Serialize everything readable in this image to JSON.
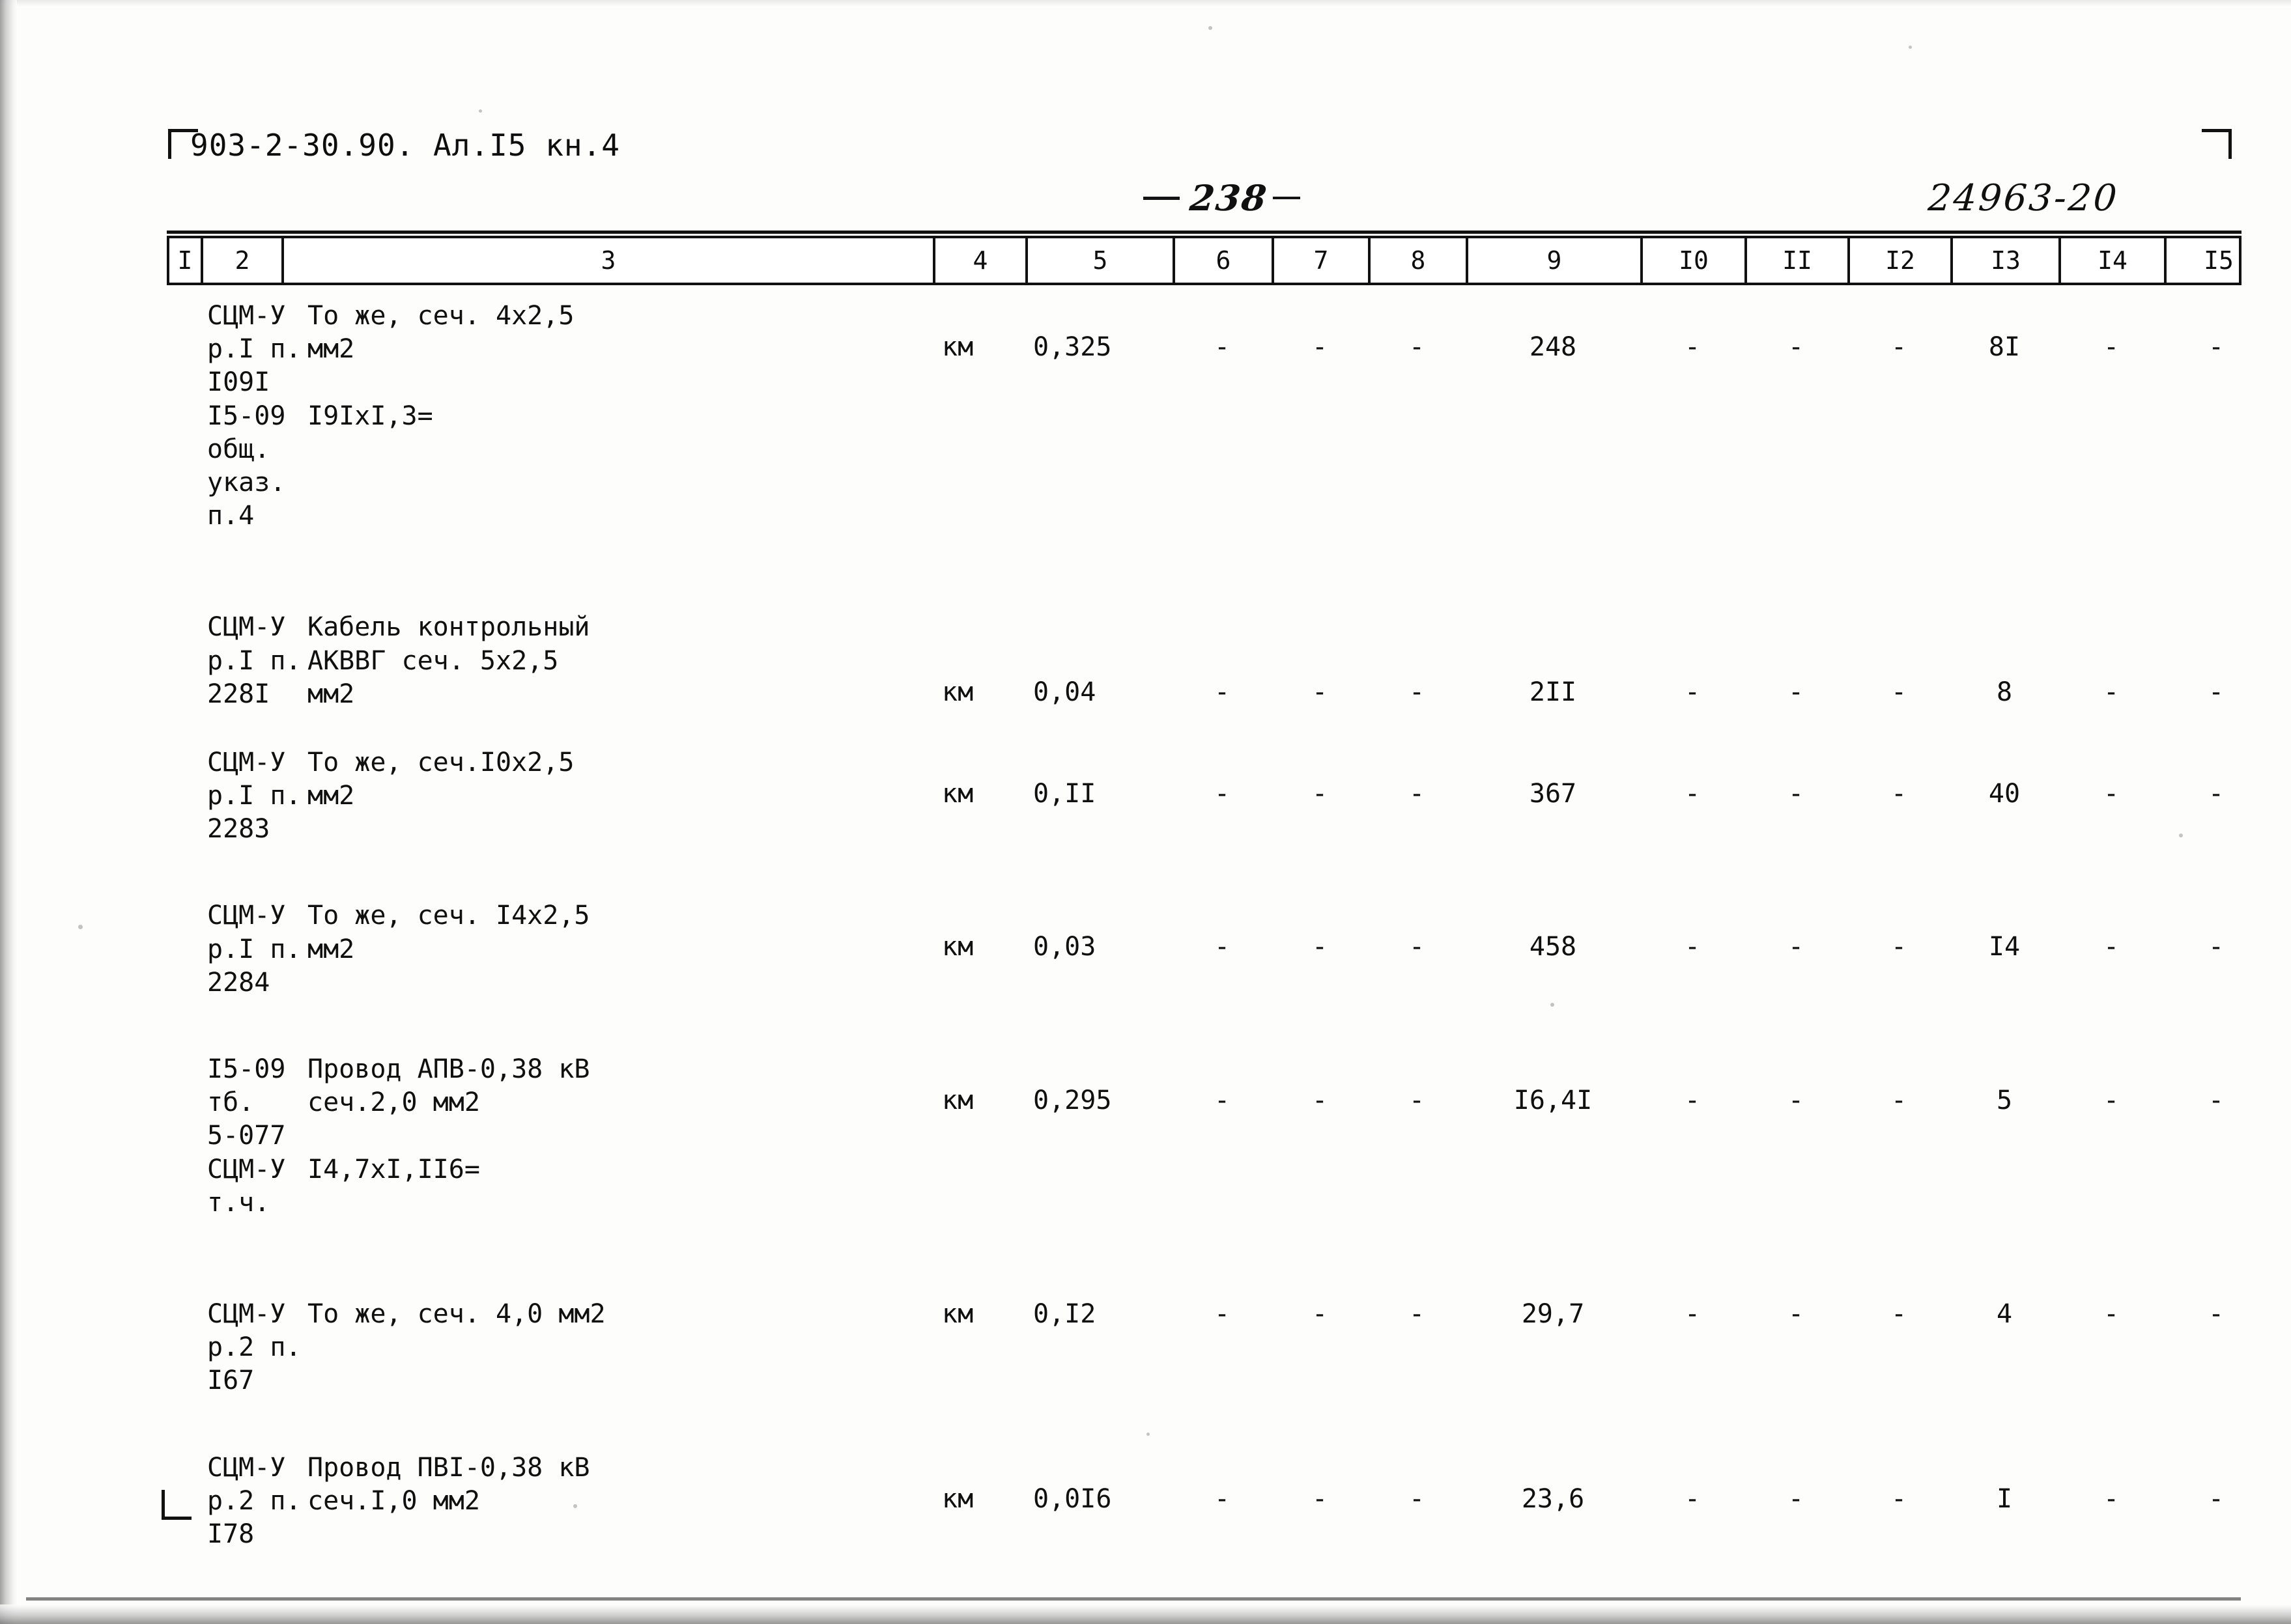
{
  "header": {
    "doc_code": "903-2-30.90. Ал.I5 кн.4",
    "page_number": "238",
    "archive_number": "24963-20"
  },
  "table": {
    "column_headers": [
      "I",
      "2",
      "3",
      "4",
      "5",
      "6",
      "7",
      "8",
      "9",
      "I0",
      "II",
      "I2",
      "I3",
      "I4",
      "I5"
    ],
    "rows": [
      {
        "col1": "",
        "col2": "СЦМ-У\nр.I п.\nI09I\nI5-09\nобщ.\nуказ.\nп.4",
        "col3": "То же, сеч. 4х2,5\nмм2\n\nI9IxI,3=",
        "col4": "км",
        "col5": "0,325",
        "col6": "-",
        "col7": "-",
        "col8": "-",
        "col9": "248",
        "col10": "-",
        "col11": "-",
        "col12": "-",
        "col13": "8I",
        "col14": "-",
        "col15": "-"
      },
      {
        "col1": "",
        "col2": "СЦМ-У\nр.I п.\n228I",
        "col3": "Кабель контрольный\nАКВВГ сеч. 5х2,5\nмм2",
        "col4": "км",
        "col5": "0,04",
        "col6": "-",
        "col7": "-",
        "col8": "-",
        "col9": "2II",
        "col10": "-",
        "col11": "-",
        "col12": "-",
        "col13": "8",
        "col14": "-",
        "col15": "-"
      },
      {
        "col1": "",
        "col2": "СЦМ-У\nр.I п.\n2283",
        "col3": "То же, сеч.I0х2,5\nмм2",
        "col4": "км",
        "col5": "0,II",
        "col6": "-",
        "col7": "-",
        "col8": "-",
        "col9": "367",
        "col10": "-",
        "col11": "-",
        "col12": "-",
        "col13": "40",
        "col14": "-",
        "col15": "-"
      },
      {
        "col1": "",
        "col2": "СЦМ-У\nр.I п.\n2284",
        "col3": "То же, сеч. I4х2,5\nмм2",
        "col4": "км",
        "col5": "0,03",
        "col6": "-",
        "col7": "-",
        "col8": "-",
        "col9": "458",
        "col10": "-",
        "col11": "-",
        "col12": "-",
        "col13": "I4",
        "col14": "-",
        "col15": "-"
      },
      {
        "col1": "",
        "col2": "I5-09\nтб.\n5-077\nСЦМ-У\nт.ч.",
        "col3": "Провод АПВ-0,38 кВ\nсеч.2,0 мм2\n\nI4,7xI,II6=",
        "col4": "км",
        "col5": "0,295",
        "col6": "-",
        "col7": "-",
        "col8": "-",
        "col9": "I6,4I",
        "col10": "-",
        "col11": "-",
        "col12": "-",
        "col13": "5",
        "col14": "-",
        "col15": "-"
      },
      {
        "col1": "",
        "col2": "СЦМ-У\nр.2 п.\nI67",
        "col3": "То же, сеч. 4,0 мм2",
        "col4": "км",
        "col5": "0,I2",
        "col6": "-",
        "col7": "-",
        "col8": "-",
        "col9": "29,7",
        "col10": "-",
        "col11": "-",
        "col12": "-",
        "col13": "4",
        "col14": "-",
        "col15": "-"
      },
      {
        "col1": "",
        "col2": "СЦМ-У\nр.2 п.\nI78",
        "col3": "Провод ПВI-0,38 кВ\nсеч.I,0 мм2",
        "col4": "км",
        "col5": "0,0I6",
        "col6": "-",
        "col7": "-",
        "col8": "-",
        "col9": "23,6",
        "col10": "-",
        "col11": "-",
        "col12": "-",
        "col13": "I",
        "col14": "-",
        "col15": "-"
      }
    ]
  }
}
